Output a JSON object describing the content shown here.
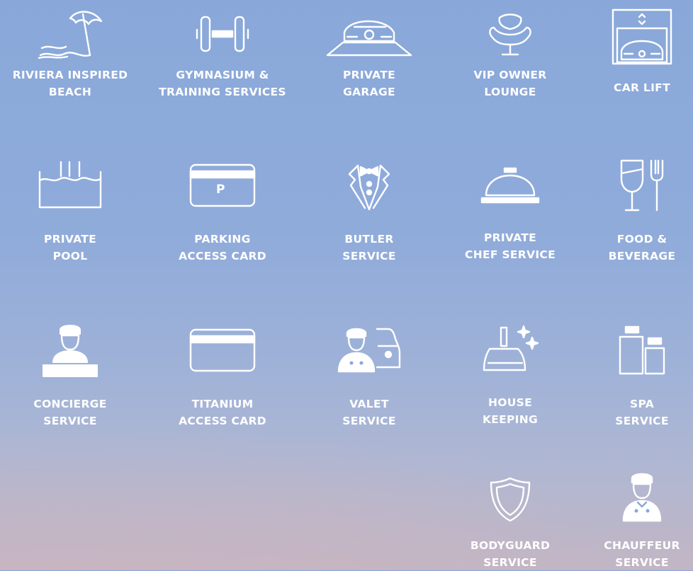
{
  "colors": {
    "icon": "#ffffff",
    "text": "#ffffff",
    "sky_top": "#89a8d9",
    "sky_bottom": "#c2b6c4"
  },
  "amenities": [
    {
      "id": "beach",
      "icon": "beach-umbrella-icon",
      "line1": "RIVIERA INSPIRED",
      "line2": "BEACH"
    },
    {
      "id": "gym",
      "icon": "dumbbell-icon",
      "line1": "GYMNASIUM &",
      "line2": "TRAINING SERVICES"
    },
    {
      "id": "garage",
      "icon": "car-garage-icon",
      "line1": "PRIVATE",
      "line2": "GARAGE"
    },
    {
      "id": "lounge",
      "icon": "lounge-chair-icon",
      "line1": "VIP OWNER",
      "line2": "LOUNGE"
    },
    {
      "id": "carlift",
      "icon": "car-lift-icon",
      "line1": "CAR LIFT",
      "line2": ""
    },
    {
      "id": "pool",
      "icon": "pool-icon",
      "line1": "PRIVATE",
      "line2": "POOL"
    },
    {
      "id": "parking",
      "icon": "parking-card-icon",
      "line1": "PARKING",
      "line2": "ACCESS CARD",
      "card_letter": "P"
    },
    {
      "id": "butler",
      "icon": "butler-tuxedo-icon",
      "line1": "BUTLER",
      "line2": "SERVICE"
    },
    {
      "id": "chef",
      "icon": "cloche-icon",
      "line1": "PRIVATE",
      "line2": "CHEF SERVICE"
    },
    {
      "id": "food",
      "icon": "wine-fork-icon",
      "line1": "FOOD &",
      "line2": "BEVERAGE"
    },
    {
      "id": "concierge",
      "icon": "concierge-icon",
      "line1": "CONCIERGE",
      "line2": "SERVICE"
    },
    {
      "id": "titanium",
      "icon": "access-card-icon",
      "line1": "TITANIUM",
      "line2": "ACCESS CARD"
    },
    {
      "id": "valet",
      "icon": "valet-car-icon",
      "line1": "VALET",
      "line2": "SERVICE"
    },
    {
      "id": "housekeeping",
      "icon": "dustpan-sparkle-icon",
      "line1": "HOUSE",
      "line2": "KEEPING"
    },
    {
      "id": "spa",
      "icon": "spa-bottles-icon",
      "line1": "SPA",
      "line2": "SERVICE"
    },
    {
      "id": "bodyguard",
      "icon": "shield-icon",
      "line1": "BODYGUARD",
      "line2": "SERVICE"
    },
    {
      "id": "chauffeur",
      "icon": "chauffeur-icon",
      "line1": "CHAUFFEUR",
      "line2": "SERVICE"
    }
  ]
}
